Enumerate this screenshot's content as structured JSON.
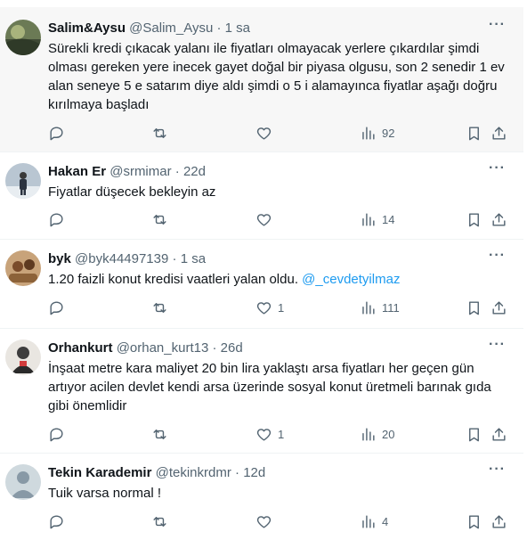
{
  "tweets": [
    {
      "name": "Salim&Aysu",
      "handle": "@Salim_Aysu",
      "time": "1 sa",
      "text": "Sürekli kredi çıkacak yalanı ile fiyatları olmayacak yerlere çıkardılar şimdi olması gereken yere inecek gayet doğal bir piyasa olgusu, son 2 senedir 1 ev alan seneye 5 e satarım diye aldı şimdi o 5 i alamayınca fiyatlar aşağı doğru kırılmaya başladı",
      "likes": "",
      "views": "92"
    },
    {
      "name": "Hakan Er",
      "handle": "@srmimar",
      "time": "22d",
      "text": "Fiyatlar düşecek bekleyin az",
      "likes": "",
      "views": "14"
    },
    {
      "name": "byk",
      "handle": "@byk44497139",
      "time": "1 sa",
      "text": "1.20 faizli konut kredisi vaatleri yalan oldu.",
      "mention": "@_cevdetyilmaz",
      "likes": "1",
      "views": "111"
    },
    {
      "name": "Orhankurt",
      "handle": "@orhan_kurt13",
      "time": "26d",
      "text": "İnşaat metre kara maliyet 20 bin lira yaklaştı arsa fiyatları her geçen gün artıyor acilen devlet  kendi arsa  üzerinde sosyal konut üretmeli  barınak gıda gibi önemlidir",
      "likes": "1",
      "views": "20"
    },
    {
      "name": "Tekin Karademir",
      "handle": "@tekinkrdmr",
      "time": "12d",
      "text": "Tuik varsa normal !",
      "likes": "",
      "views": "4"
    }
  ],
  "separator": "·",
  "colors": {
    "text": "#0f1419",
    "muted": "#536471",
    "link": "#1d9bf0",
    "highlight_bg": "#f7f7f7"
  }
}
